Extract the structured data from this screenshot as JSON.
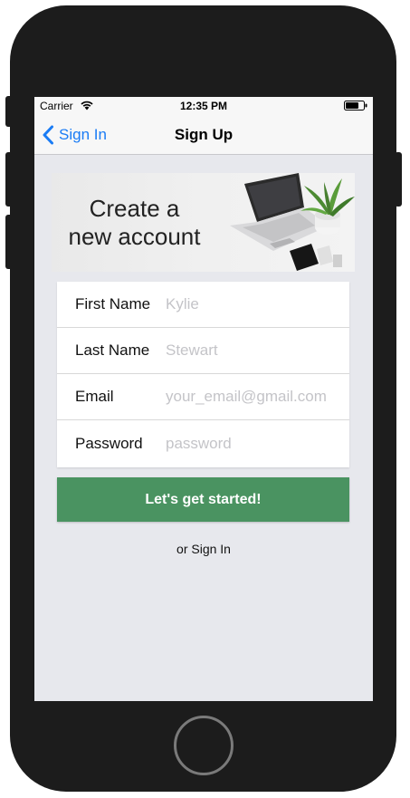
{
  "status_bar": {
    "carrier": "Carrier",
    "time": "12:35 PM"
  },
  "nav": {
    "back_label": "Sign In",
    "title": "Sign Up"
  },
  "banner": {
    "title": "Create a\nnew account"
  },
  "form": {
    "fields": [
      {
        "label": "First Name",
        "placeholder": "Kylie"
      },
      {
        "label": "Last Name",
        "placeholder": "Stewart"
      },
      {
        "label": "Email",
        "placeholder": "your_email@gmail.com"
      },
      {
        "label": "Password",
        "placeholder": "password"
      }
    ]
  },
  "cta": {
    "label": "Let's get started!"
  },
  "alt_link": {
    "label": "or Sign In"
  },
  "colors": {
    "accent_blue": "#1a7cf5",
    "cta_green": "#4a9361",
    "screen_bg": "#e7e8ed",
    "phone_body": "#1c1c1c"
  }
}
